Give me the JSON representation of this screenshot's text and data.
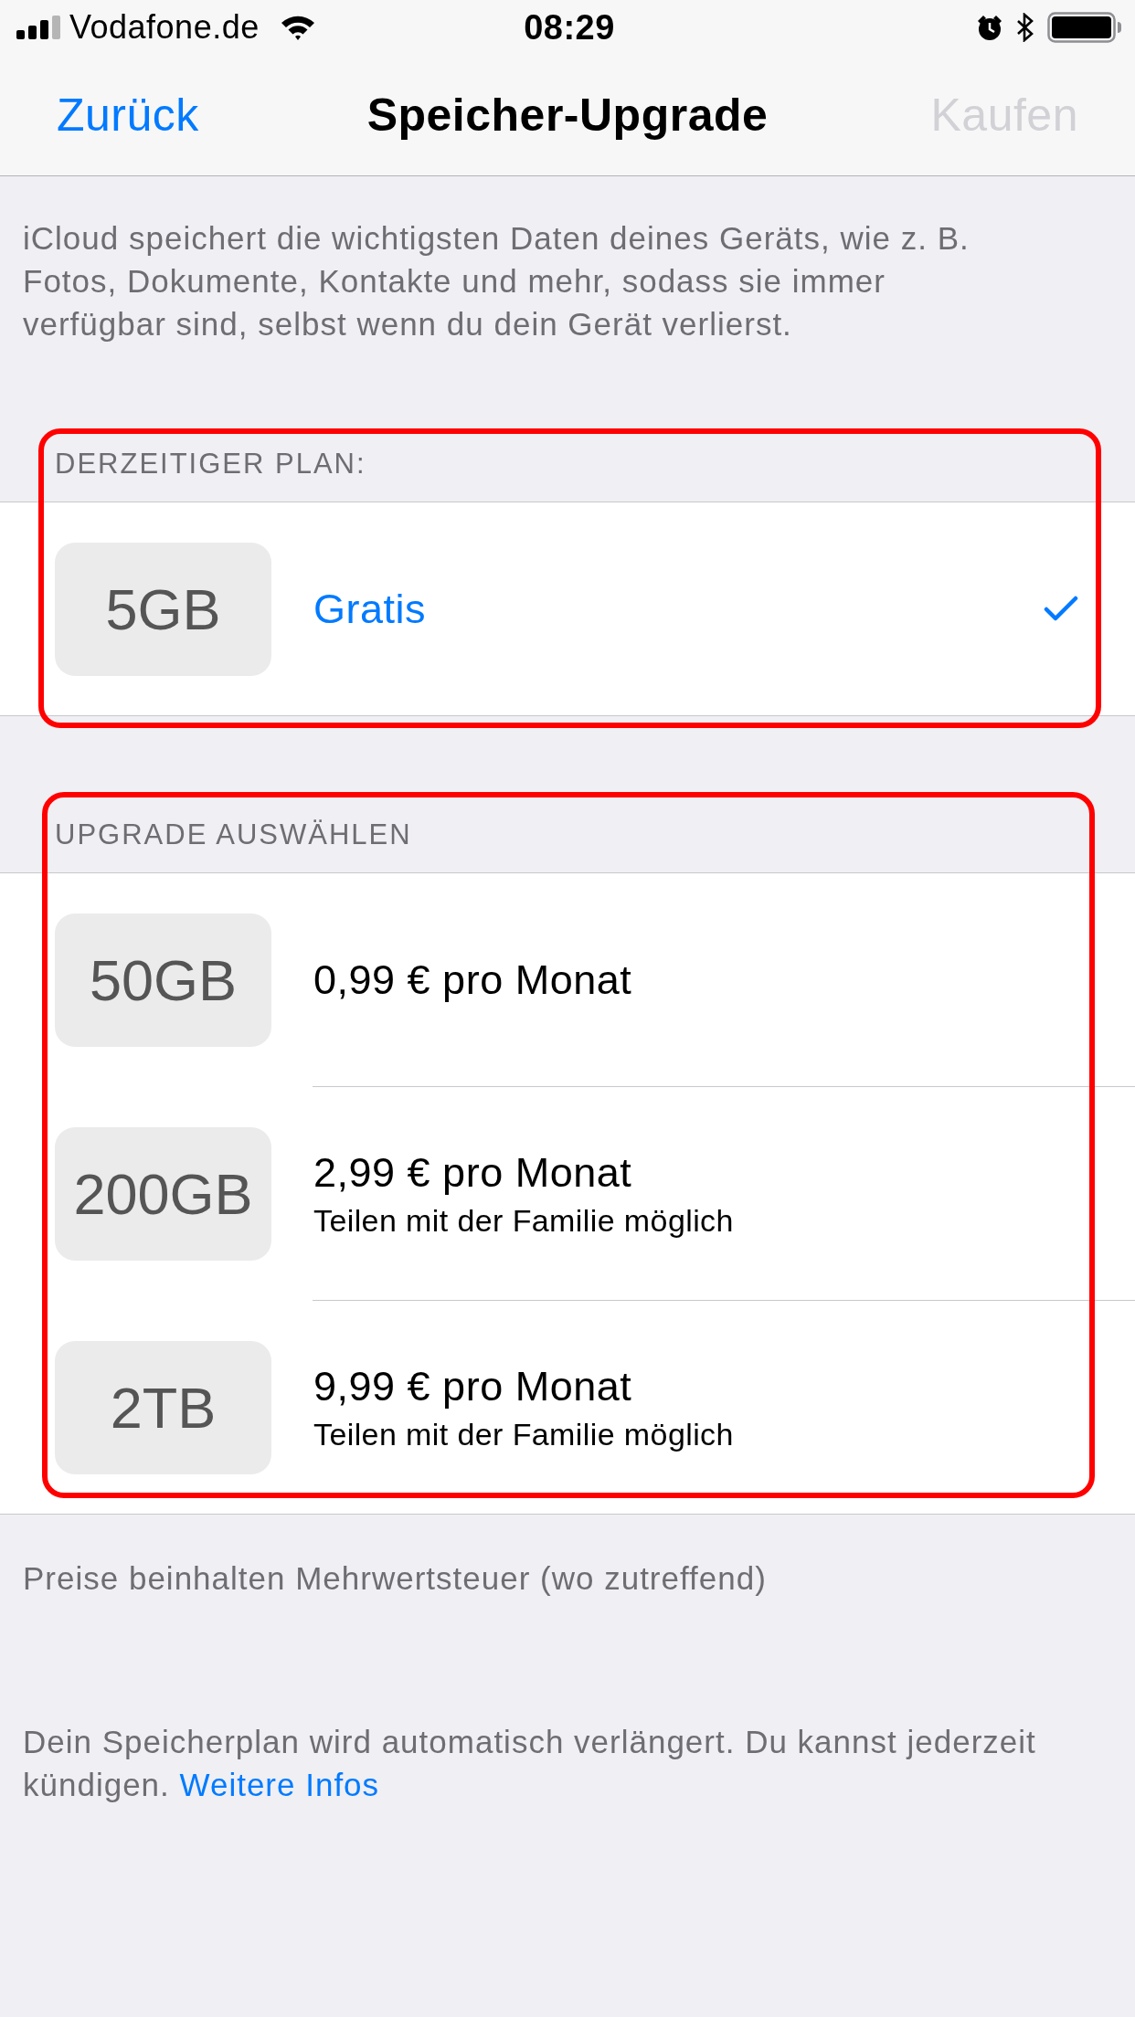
{
  "status_bar": {
    "carrier": "Vodafone.de",
    "time": "08:29"
  },
  "nav_bar": {
    "back": "Zurück",
    "title": "Speicher-Upgrade",
    "action": {
      "label": "Kaufen",
      "disabled": true
    }
  },
  "description": "iCloud speichert die wichtigsten Daten deines Geräts, wie z. B. Fotos, Dokumente, Kontakte und mehr, sodass sie immer verfügbar sind, selbst wenn du dein Gerät verlierst.",
  "sections": [
    {
      "header": "DERZEITIGER PLAN:",
      "highlighted": true,
      "plans": [
        {
          "kind": "current",
          "size": "5GB",
          "price": "Gratis",
          "selected": true
        }
      ]
    },
    {
      "header": "UPGRADE AUSWÄHLEN",
      "highlighted": true,
      "plans": [
        {
          "kind": "upgrade",
          "size": "50GB",
          "price": "0,99 € pro Monat",
          "selected": false
        },
        {
          "kind": "upgrade",
          "size": "200GB",
          "price": "2,99 € pro Monat",
          "note": "Teilen mit der Familie möglich",
          "selected": false
        },
        {
          "kind": "upgrade",
          "size": "2TB",
          "price": "9,99 € pro Monat",
          "note": "Teilen mit der Familie möglich",
          "selected": false
        }
      ]
    }
  ],
  "footer": {
    "vat_note": "Preise beinhalten Mehrwertsteuer (wo zutreffend)",
    "renewal_text": "Dein Speicherplan wird automatisch verlängert. Du kannst jederzeit kündigen.",
    "link": "Weitere Infos"
  }
}
